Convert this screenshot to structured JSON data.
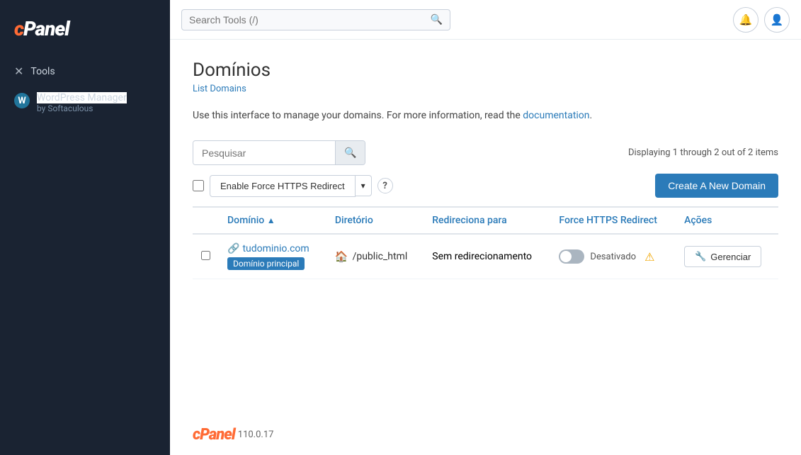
{
  "sidebar": {
    "logo": "cPanel",
    "items": [
      {
        "id": "tools",
        "label": "Tools",
        "icon": "✕"
      },
      {
        "id": "wordpress",
        "label": "WordPress Manager",
        "sub": "by Softaculous"
      }
    ]
  },
  "header": {
    "search_placeholder": "Search Tools (/)",
    "notification_icon": "bell",
    "user_icon": "user"
  },
  "page": {
    "title": "Domínios",
    "breadcrumb": "List Domains",
    "info_text": "Use this interface to manage your domains. For more information, read the",
    "info_link_text": "documentation",
    "info_text_end": ".",
    "search_placeholder": "Pesquisar",
    "stats": "Displaying 1 through 2 out of 2 items",
    "https_button": "Enable Force HTTPS Redirect",
    "create_button": "Create A New Domain",
    "table": {
      "columns": [
        {
          "id": "checkbox",
          "label": ""
        },
        {
          "id": "domain",
          "label": "Domínio"
        },
        {
          "id": "directory",
          "label": "Diretório"
        },
        {
          "id": "redirect",
          "label": "Redireciona para"
        },
        {
          "id": "force",
          "label": "Force HTTPS Redirect"
        },
        {
          "id": "actions",
          "label": "Ações"
        }
      ],
      "rows": [
        {
          "id": 1,
          "domain": "tudominio.com",
          "badge": "Domínio principal",
          "directory": "/public_html",
          "redirect": "Sem redirecionamento",
          "force_status": "Desativado",
          "toggle_on": false,
          "manage_label": "Gerenciar"
        }
      ]
    }
  },
  "footer": {
    "logo": "cPanel",
    "version": "110.0.17"
  }
}
